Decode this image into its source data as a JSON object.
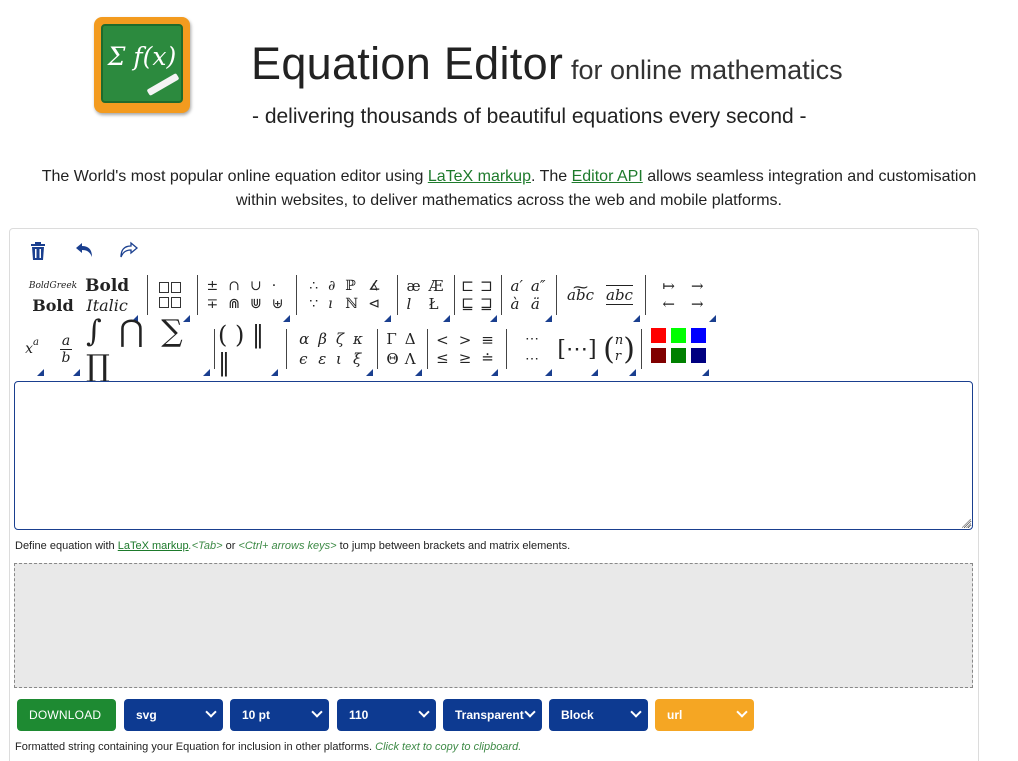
{
  "header": {
    "logo_text": "Σ f(x)",
    "title": "Equation Editor",
    "title_suffix": "for online mathematics",
    "tagline": "- delivering thousands of beautiful equations every second -"
  },
  "intro": {
    "part1": "The World's most popular online equation editor using ",
    "link1": "LaTeX markup",
    "part2": ". The ",
    "link2": "Editor API",
    "part3": " allows seamless integration and customisation within websites, to deliver mathematics across the web and mobile platforms."
  },
  "toolbar": {
    "icons": [
      "trash-icon",
      "undo-icon",
      "redo-icon"
    ],
    "row1": {
      "style_top_left": "BoldGreek",
      "style_top_right": "Bold",
      "style_bottom_left": "Bold",
      "style_bottom_right": "Italic",
      "ops": [
        "±",
        "∩",
        "∪",
        "·",
        "∓",
        "⋒",
        "⋓",
        "⊎"
      ],
      "logic": [
        "∴",
        "∂",
        "ℙ",
        "∡",
        "∵",
        "ı",
        "ℕ",
        "⊲"
      ],
      "foreign": [
        "æ",
        "Æ",
        "l",
        "Ł"
      ],
      "subsets": [
        "⊏",
        "⊐",
        "⊑",
        "⊒"
      ],
      "accents": [
        "a′",
        "a″",
        "à",
        "ä"
      ],
      "accents2": [
        "abc",
        "abc"
      ],
      "arrows": [
        "↦",
        "→",
        "←",
        "→"
      ]
    },
    "row2": {
      "sup": "x",
      "sup_exp": "a",
      "frac_num": "a",
      "frac_den": "b",
      "bigops": "∫ ⋂ ∑ ∏",
      "brackets": "( ) ‖ ‖",
      "greek_lower": [
        "α",
        "β",
        "ζ",
        "κ",
        "ϵ",
        "ε",
        "ι",
        "ξ"
      ],
      "greek_upper": [
        "Γ",
        "Δ",
        "Θ",
        "Λ"
      ],
      "relations": [
        "<",
        ">",
        "≡",
        "≤",
        "≥",
        "≐"
      ],
      "dots": [
        "⋯",
        "⋯"
      ],
      "matrix": "[⋯]",
      "binom_top": "n",
      "binom_bottom": "r",
      "colors": [
        "#ff0000",
        "#00ff00",
        "#0000ff",
        "#800000",
        "#008000",
        "#000080"
      ]
    }
  },
  "editor": {
    "value": "",
    "help_prefix": "Define equation with ",
    "help_link": "LaTeX markup",
    "help_tab": ".<Tab>",
    "help_or": " or ",
    "help_keys": "<Ctrl+ arrows keys>",
    "help_suffix": " to jump between brackets and matrix elements."
  },
  "controls": {
    "download": "DOWNLOAD",
    "format": "svg",
    "size": "10 pt",
    "dpi": "110",
    "background": "Transparent",
    "display": "Block",
    "output": "url",
    "colors": {
      "primary": "#0d3a91",
      "download": "#1e8a32",
      "output": "#f5a623"
    }
  },
  "footer": {
    "note": "Formatted string containing your Equation for inclusion in other platforms. ",
    "copy_hint": "Click text to copy to clipboard."
  }
}
